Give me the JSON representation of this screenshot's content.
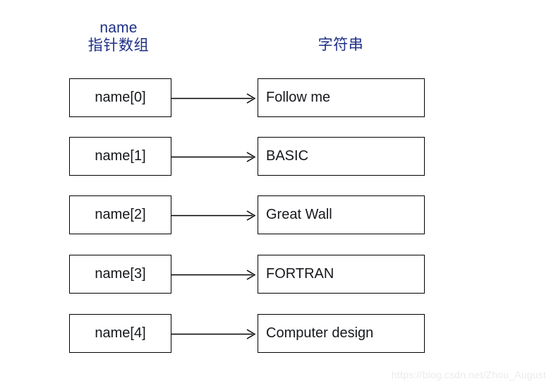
{
  "headers": {
    "left_en": "name",
    "left_cn": "指针数组",
    "right_cn": "字符串"
  },
  "colors": {
    "header_text": "#1d2f87",
    "box_border": "#000000",
    "box_text": "#16181c",
    "arrow": "#000000",
    "background": "#ffffff",
    "watermark": "#ebebeb"
  },
  "rows": [
    {
      "pointer": "name[0]",
      "string": "Follow me"
    },
    {
      "pointer": "name[1]",
      "string": "BASIC"
    },
    {
      "pointer": "name[2]",
      "string": "Great Wall"
    },
    {
      "pointer": "name[3]",
      "string": "FORTRAN"
    },
    {
      "pointer": "name[4]",
      "string": "Computer design"
    }
  ],
  "watermark": "https://blog.csdn.net/Zhou_August"
}
